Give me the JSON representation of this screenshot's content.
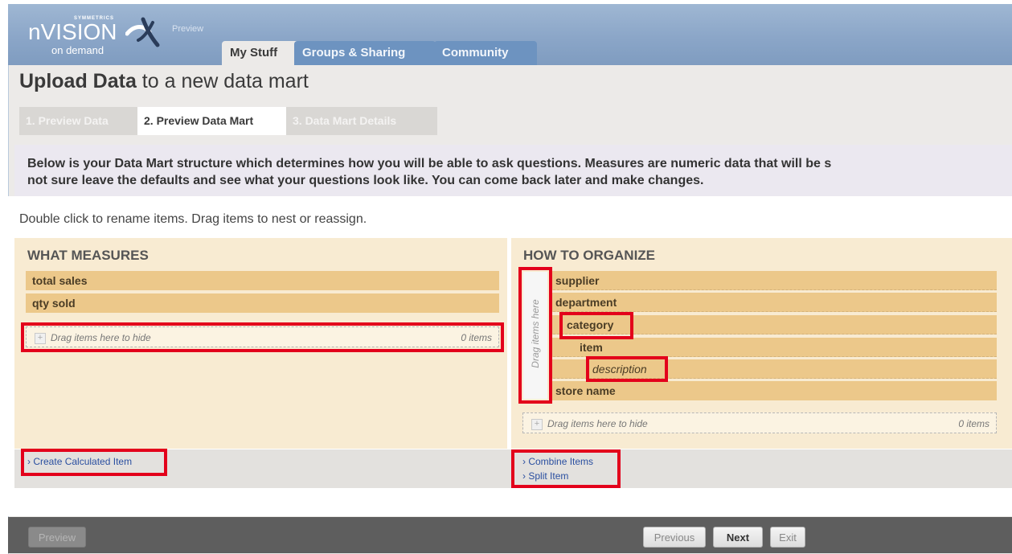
{
  "app": {
    "brand_small": "SYMMETRICS",
    "brand_main": "nVISION",
    "brand_sub": "on demand",
    "preview_tag": "Preview"
  },
  "tabs": [
    {
      "label": "My Stuff",
      "active": true
    },
    {
      "label": "Groups & Sharing",
      "active": false
    },
    {
      "label": "Community",
      "active": false
    }
  ],
  "page": {
    "title_bold": "Upload Data",
    "title_rest": " to a new data mart"
  },
  "steps": [
    {
      "label": "1. Preview Data",
      "state": "done"
    },
    {
      "label": "2. Preview Data Mart",
      "state": "current"
    },
    {
      "label": "3. Data Mart Details",
      "state": "pending"
    }
  ],
  "instructions": {
    "line1": "Below is your Data Mart structure which determines how you will be able to ask questions.  Measures are numeric data that will be s",
    "line2": "not sure leave the defaults and see what your questions look like.  You can come back later and make changes."
  },
  "hint": "Double click to rename items.  Drag items to nest or reassign.",
  "measures": {
    "title": "WHAT MEASURES",
    "items": [
      "total sales",
      "qty sold"
    ],
    "hide_zone": "Drag items here to hide",
    "hide_count": "0 items",
    "links": [
      "Create Calculated Item"
    ]
  },
  "organize": {
    "title": "HOW TO ORGANIZE",
    "drag_label": "Drag items here",
    "items": [
      "supplier",
      "department",
      "category",
      "item",
      "description",
      "store name"
    ],
    "hide_zone": "Drag items here to hide",
    "hide_count": "0 items",
    "links": [
      "Combine Items",
      "Split Item"
    ]
  },
  "buttons": {
    "preview": "Preview",
    "previous": "Previous",
    "next": "Next",
    "exit": "Exit"
  },
  "colors": {
    "header": "#8ba6c8",
    "tab_inactive": "#6d93c0",
    "panel": "#f8ebd2",
    "row": "#ecc88a",
    "highlight": "#e3001b",
    "bottom_bar": "#5e5e5e"
  }
}
